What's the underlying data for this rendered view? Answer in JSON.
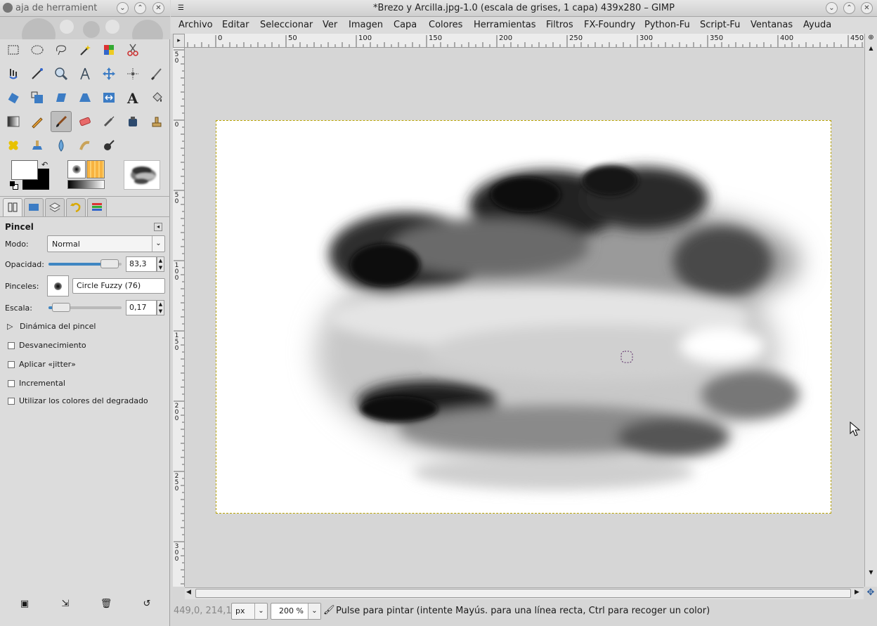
{
  "toolbox": {
    "title": "aja de herramient",
    "tabs": [
      "tool-options",
      "device-status",
      "layers",
      "undo-history",
      "palettes"
    ],
    "options": {
      "heading": "Pincel",
      "mode_label": "Modo:",
      "mode_value": "Normal",
      "opacity_label": "Opacidad:",
      "opacity_value": "83,3",
      "opacity_fraction": 0.833,
      "brushes_label": "Pinceles:",
      "brush_name": "Circle Fuzzy (76)",
      "scale_label": "Escala:",
      "scale_value": "0,17",
      "scale_fraction": 0.17,
      "dynamics_label": "Dinámica del pincel",
      "fade_label": "Desvanecimiento",
      "jitter_label": "Aplicar «jitter»",
      "incremental_label": "Incremental",
      "gradient_colors_label": "Utilizar los colores del degradado"
    },
    "colors": {
      "foreground": "#000000",
      "background": "#ffffff"
    }
  },
  "image_window": {
    "title": "*Brezo y Arcilla.jpg-1.0 (escala de grises, 1 capa) 439x280 – GIMP",
    "menu": [
      "Archivo",
      "Editar",
      "Seleccionar",
      "Ver",
      "Imagen",
      "Capa",
      "Colores",
      "Herramientas",
      "Filtros",
      "FX-Foundry",
      "Python-Fu",
      "Script-Fu",
      "Ventanas",
      "Ayuda"
    ],
    "hruler_labels": [
      "0",
      "50",
      "100",
      "150",
      "200",
      "250",
      "300",
      "350",
      "400",
      "450"
    ],
    "vruler_labels": [
      "5 0",
      "0",
      "5 0",
      "1 0 0",
      "1 5 0",
      "2 0 0",
      "2 5 0",
      "3 0 0"
    ],
    "status": {
      "coords": "449,0, 214,1",
      "unit": "px",
      "zoom": "200 %",
      "hint": "Pulse para pintar (intente Mayús. para una línea recta, Ctrl para recoger un color)"
    }
  }
}
